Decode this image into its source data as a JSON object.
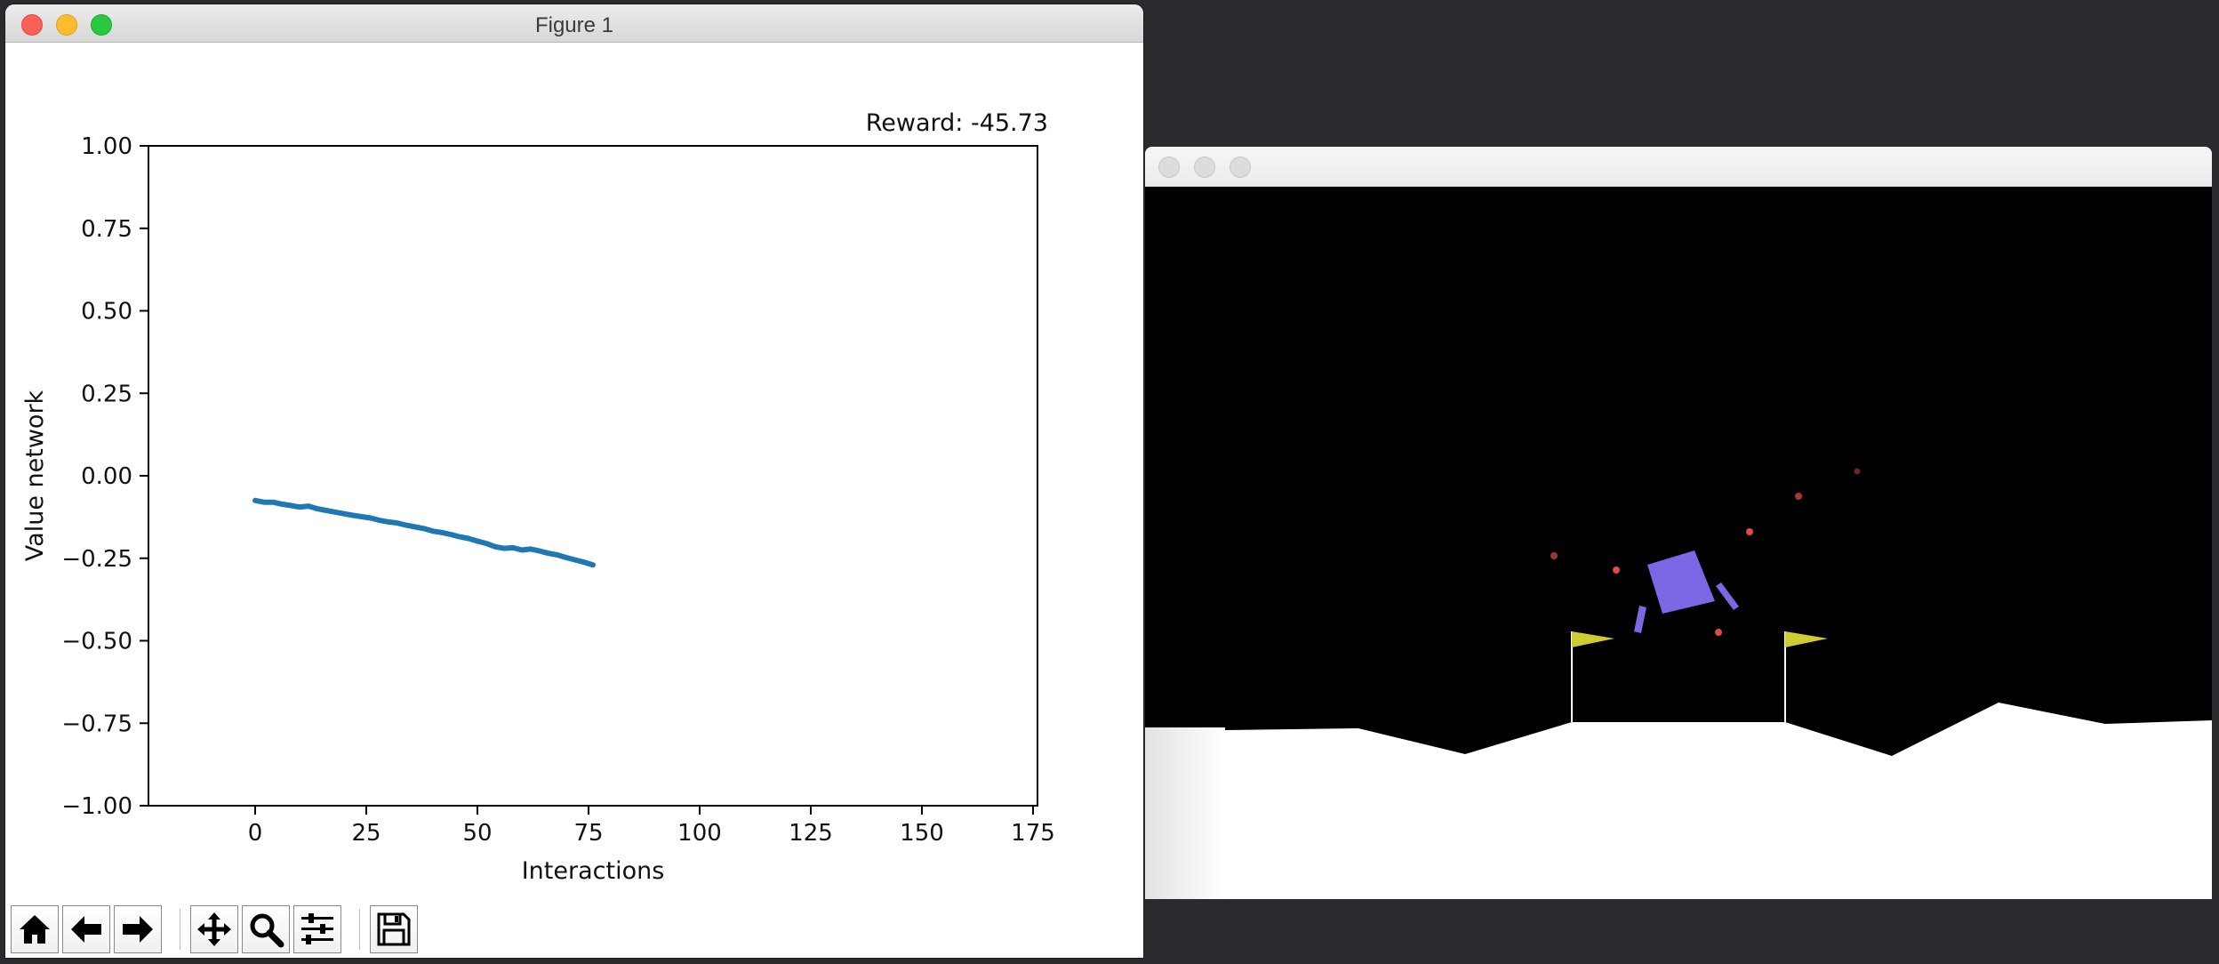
{
  "figure_window": {
    "title": "Figure 1",
    "toolbar": {
      "home_icon": "home-icon",
      "back_icon": "arrow-left-icon",
      "forward_icon": "arrow-right-icon",
      "pan_icon": "move-icon",
      "zoom_icon": "magnifier-icon",
      "configure_icon": "sliders-icon",
      "save_icon": "floppy-disk-icon"
    }
  },
  "chart_data": {
    "type": "line",
    "title": "Reward: -45.73",
    "xlabel": "Interactions",
    "ylabel": "Value network",
    "xlim": [
      -24,
      176
    ],
    "ylim": [
      -1.0,
      1.0
    ],
    "xticks": [
      0,
      25,
      50,
      75,
      100,
      125,
      150,
      175
    ],
    "xtick_labels": [
      "0",
      "25",
      "50",
      "75",
      "100",
      "125",
      "150",
      "175"
    ],
    "yticks": [
      1.0,
      0.75,
      0.5,
      0.25,
      0.0,
      -0.25,
      -0.5,
      -0.75,
      -1.0
    ],
    "ytick_labels": [
      "1.00",
      "0.75",
      "0.50",
      "0.25",
      "0.00",
      "−0.25",
      "−0.50",
      "−0.75",
      "−1.00"
    ],
    "grid": false,
    "line_color": "#1f77b4",
    "series": [
      {
        "x": [
          0,
          2,
          4,
          6,
          8,
          10,
          12,
          14,
          16,
          18,
          20,
          22,
          24,
          26,
          28,
          30,
          32,
          34,
          36,
          38,
          40,
          42,
          44,
          46,
          48,
          50,
          52,
          54,
          56,
          58,
          60,
          62,
          64,
          66,
          68,
          70,
          72,
          74,
          76
        ],
        "values": [
          -0.075,
          -0.08,
          -0.08,
          -0.086,
          -0.09,
          -0.095,
          -0.092,
          -0.1,
          -0.105,
          -0.11,
          -0.115,
          -0.12,
          -0.124,
          -0.128,
          -0.135,
          -0.14,
          -0.143,
          -0.15,
          -0.155,
          -0.16,
          -0.168,
          -0.172,
          -0.178,
          -0.185,
          -0.19,
          -0.198,
          -0.205,
          -0.215,
          -0.22,
          -0.218,
          -0.225,
          -0.222,
          -0.228,
          -0.235,
          -0.24,
          -0.248,
          -0.255,
          -0.262,
          -0.27
        ]
      }
    ]
  },
  "game_window": {
    "colors": {
      "sky": "#000000",
      "ground": "#ffffff",
      "lander": "#7d67e4",
      "flag": "#cdcd33",
      "particle": "#e14a4a"
    }
  }
}
